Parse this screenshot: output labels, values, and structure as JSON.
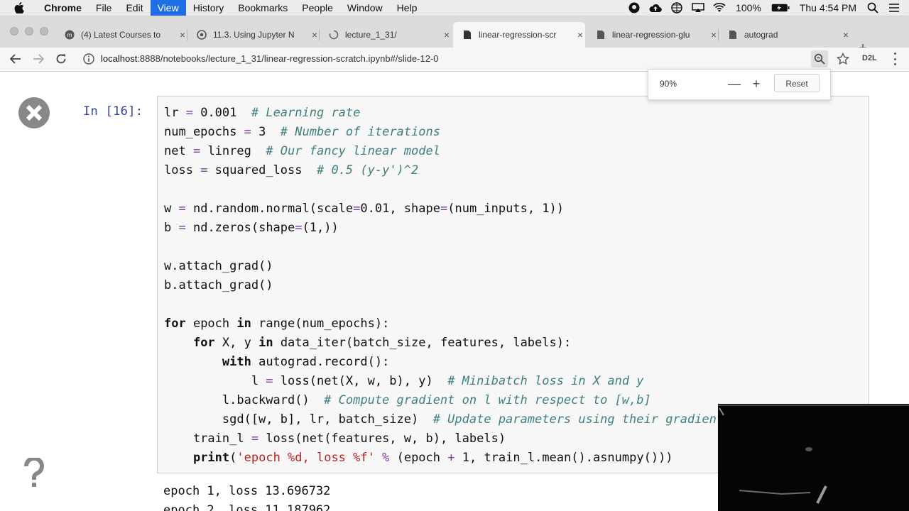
{
  "menubar": {
    "app": "Chrome",
    "items": [
      "File",
      "Edit",
      "View",
      "History",
      "Bookmarks",
      "People",
      "Window",
      "Help"
    ],
    "active_item": "View",
    "battery": "100%",
    "clock": "Thu 4:54 PM"
  },
  "tabs": [
    {
      "label": "(4) Latest Courses to",
      "icon": "coursera-icon"
    },
    {
      "label": "11.3. Using Jupyter N",
      "icon": "chrome-page-icon"
    },
    {
      "label": "lecture_1_31/",
      "icon": "loading-icon"
    },
    {
      "label": "linear-regression-scr",
      "icon": "document-icon",
      "active": true
    },
    {
      "label": "linear-regression-glu",
      "icon": "document-icon"
    },
    {
      "label": "autograd",
      "icon": "document-icon"
    }
  ],
  "toolbar": {
    "url_host": "localhost",
    "url_rest": ":8888/notebooks/lecture_1_31/linear-regression-scratch.ipynb#/slide-12-0",
    "extension_label": "D2L"
  },
  "zoom_popup": {
    "value": "90%",
    "minus": "—",
    "plus": "+",
    "reset": "Reset"
  },
  "notebook": {
    "prompt": "In [16]:",
    "output_lines": [
      "epoch 1, loss 13.696732",
      "epoch 2, loss 11.187962"
    ]
  },
  "colors": {
    "menu_highlight": "#1f6ee6",
    "prompt_blue": "#303f9f",
    "keyword_green": "#008000",
    "comment_teal": "#408080",
    "string_red": "#ba2121"
  }
}
